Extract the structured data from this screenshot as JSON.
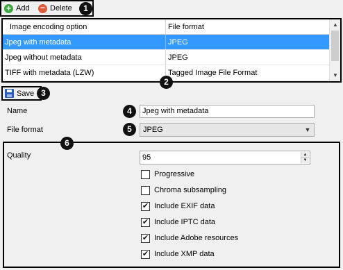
{
  "toolbar": {
    "add_label": "Add",
    "delete_label": "Delete",
    "add_icon": "plus-circle-icon",
    "delete_icon": "minus-circle-icon"
  },
  "badges": [
    "1",
    "2",
    "3",
    "4",
    "5",
    "6"
  ],
  "table": {
    "columns": [
      "Image encoding option",
      "File format"
    ],
    "rows": [
      {
        "option": "Jpeg with metadata",
        "format": "JPEG",
        "selected": true
      },
      {
        "option": "Jpeg without metadata",
        "format": "JPEG",
        "selected": false
      },
      {
        "option": "TIFF with metadata (LZW)",
        "format": "Tagged Image File Format",
        "selected": false
      }
    ],
    "selection_color": "#3399ff"
  },
  "save": {
    "label": "Save",
    "icon": "floppy-disk-icon"
  },
  "form": {
    "name_label": "Name",
    "name_value": "Jpeg with metadata",
    "format_label": "File format",
    "format_value": "JPEG"
  },
  "options": {
    "quality_label": "Quality",
    "quality_value": "95",
    "checks": [
      {
        "label": "Progressive",
        "checked": false
      },
      {
        "label": "Chroma subsampling",
        "checked": false
      },
      {
        "label": "Include EXIF data",
        "checked": true
      },
      {
        "label": "Include IPTC data",
        "checked": true
      },
      {
        "label": "Include Adobe resources",
        "checked": true
      },
      {
        "label": "Include XMP data",
        "checked": true
      }
    ]
  }
}
